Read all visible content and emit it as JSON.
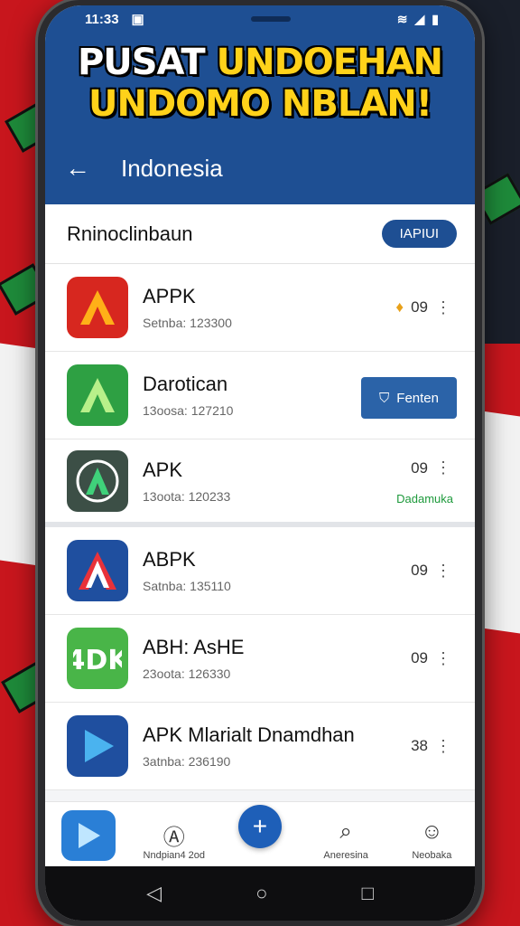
{
  "status": {
    "time": "11:33"
  },
  "banner": {
    "line1_white": "PUSAT",
    "line1_yellow": " UNDOEHAN",
    "line2": "UNDOMO NBLAN!"
  },
  "appbar": {
    "title": "Indonesia"
  },
  "section": {
    "title": "Rninoclinbaun",
    "pill": "IAPIUI"
  },
  "apps": [
    {
      "name": "APPK",
      "sub": "Setnba: 123300",
      "right": "09",
      "icon": "red-a-app-icon",
      "color": "#d7271f"
    },
    {
      "name": "Darotican",
      "sub": "13oosa: 127210",
      "button": "Fenten",
      "icon": "green-a-app-icon",
      "color": "#2ea043"
    },
    {
      "name": "APK",
      "sub": "13oota: 120233",
      "right": "09",
      "tag": "Dadamuka",
      "icon": "apk-a-app-icon",
      "color": "#3c4f46"
    },
    {
      "name": "ABPK",
      "sub": "Satnba: 135110",
      "right": "09",
      "icon": "blue-a-app-icon",
      "color": "#1f4f9f"
    },
    {
      "name": "ABH: AsHE",
      "sub": "23oota: 126330",
      "right": "09",
      "icon": "apk-green-app-icon",
      "color": "#49b548"
    },
    {
      "name": "APK Mlarialt Dnamdhan",
      "sub": "3atnba: 236190",
      "right": "38",
      "icon": "play-app-icon",
      "color": "#1f4f9f"
    }
  ],
  "bottom_nav": [
    {
      "label": "Nndpian4 2od"
    },
    {
      "label": "Aneresina"
    },
    {
      "label": "Neobaka"
    }
  ]
}
